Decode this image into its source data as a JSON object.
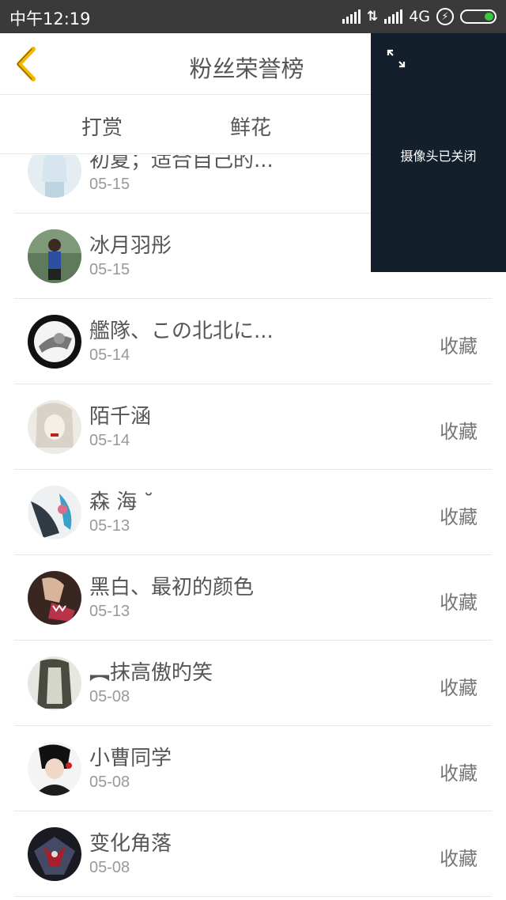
{
  "status_bar": {
    "time": "中午12:19",
    "network": "4G",
    "battery_level": 0.3
  },
  "header": {
    "title": "粉丝荣誉榜",
    "back_icon": "chevron-left-icon",
    "accent_color": "#f5b800"
  },
  "tabs": [
    {
      "label": "打赏"
    },
    {
      "label": "鲜花"
    }
  ],
  "list": {
    "items": [
      {
        "name": "初夏；适合自己的...",
        "date": "05-15",
        "action": ""
      },
      {
        "name": "冰月羽彤",
        "date": "05-15",
        "action": ""
      },
      {
        "name": "艦隊、この北北に...",
        "date": "05-14",
        "action": "收藏"
      },
      {
        "name": "陌千涵",
        "date": "05-14",
        "action": "收藏"
      },
      {
        "name": "森 海 ˘",
        "date": "05-13",
        "action": "收藏"
      },
      {
        "name": "黑白、最初的颜色",
        "date": "05-13",
        "action": "收藏"
      },
      {
        "name": "︻抹高傲旳笑",
        "date": "05-08",
        "action": "收藏"
      },
      {
        "name": "小曹同学",
        "date": "05-08",
        "action": "收藏"
      },
      {
        "name": "变化角落",
        "date": "05-08",
        "action": "收藏"
      }
    ]
  },
  "camera_overlay": {
    "message": "摄像头已关闭",
    "expand_icon": "expand-icon",
    "background": "#13202b"
  }
}
